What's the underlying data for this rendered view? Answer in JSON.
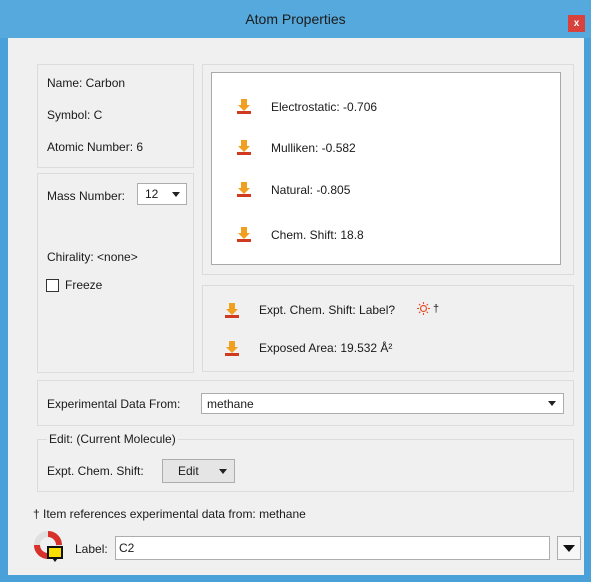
{
  "window": {
    "title": "Atom Properties",
    "close_glyph": "x"
  },
  "info": {
    "name": "Name:  Carbon",
    "symbol": "Symbol:  C",
    "atomic_number": "Atomic Number:  6"
  },
  "mass": {
    "label": "Mass Number:",
    "value": "12",
    "chirality": "Chirality:  <none>",
    "freeze": "Freeze"
  },
  "charges": [
    {
      "label": "Electrostatic: -0.706"
    },
    {
      "label": "Mulliken: -0.582"
    },
    {
      "label": "Natural: -0.805"
    },
    {
      "label": "Chem. Shift: 18.8"
    }
  ],
  "expt": {
    "shift_label": "Expt. Chem. Shift: Label?",
    "dagger": "†",
    "exposed_area": "Exposed Area: 19.532 Å²"
  },
  "experimental": {
    "label": "Experimental Data From:",
    "value": "methane"
  },
  "edit_group": {
    "title": "Edit: (Current Molecule)",
    "field_label": "Expt. Chem. Shift:",
    "button": "Edit"
  },
  "footnote": "† Item references experimental data from: methane",
  "label_row": {
    "label": "Label:",
    "value": "C2"
  },
  "colors": {
    "titlebar": "#56a9dc",
    "close": "#d9413d",
    "icon_orange": "#f0a020",
    "icon_red": "#d03a1e"
  }
}
